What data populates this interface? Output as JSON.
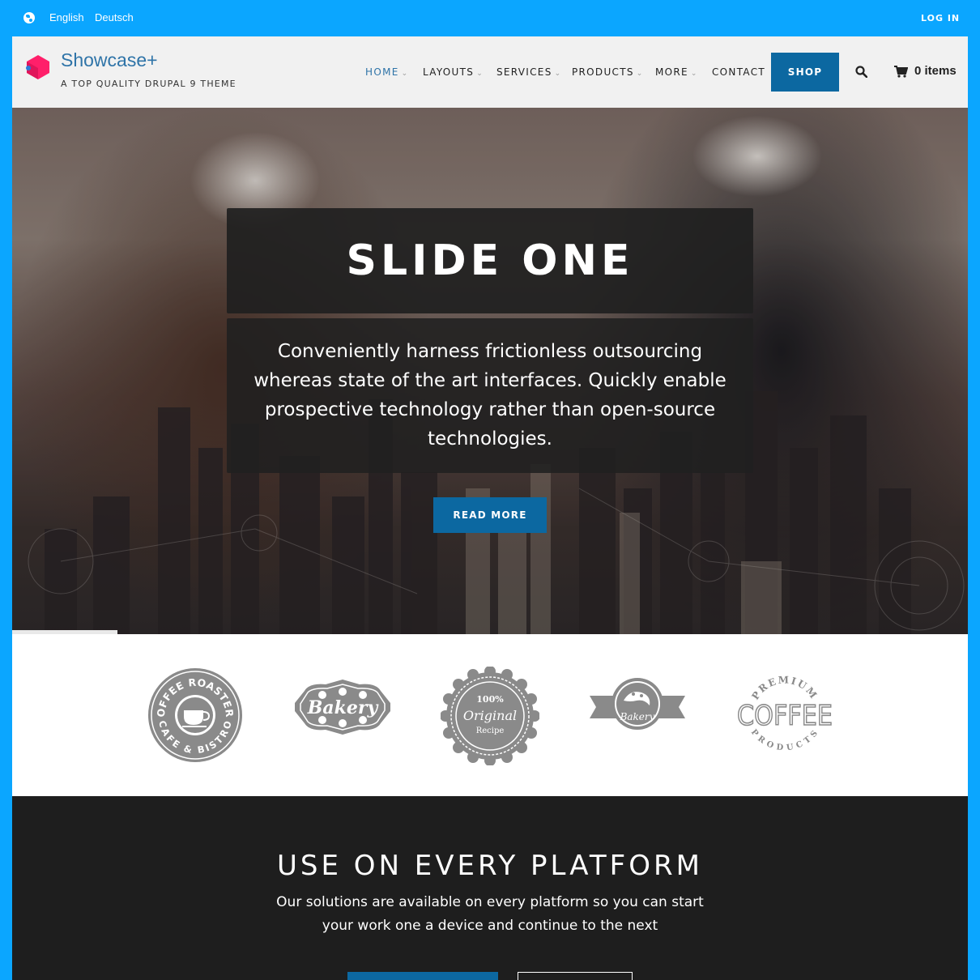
{
  "topbar": {
    "languages": [
      "English",
      "Deutsch"
    ],
    "login_label": "LOG IN"
  },
  "header": {
    "site_name": "Showcase+",
    "slogan": "A TOP QUALITY DRUPAL 9 THEME",
    "nav": [
      {
        "label": "HOME",
        "has_dropdown": true,
        "active": true
      },
      {
        "label": "LAYOUTS",
        "has_dropdown": true
      },
      {
        "label": "SERVICES",
        "has_dropdown": true
      },
      {
        "label": "PRODUCTS",
        "has_dropdown": true
      },
      {
        "label": "MORE",
        "has_dropdown": true
      },
      {
        "label": "CONTACT",
        "has_dropdown": false
      }
    ],
    "shop_label": "SHOP",
    "cart_label": "0 items",
    "icons": {
      "search": "search-icon",
      "cart": "cart-icon",
      "language": "globe-icon",
      "chevron": "chevron-down-icon"
    }
  },
  "slider": {
    "title": "SLIDE ONE",
    "body": "Conveniently harness frictionless outsourcing whereas state of the art interfaces. Quickly enable prospective technology rather than open-source technologies.",
    "button_label": "READ MORE"
  },
  "logos": {
    "coffee_roasters": {
      "top": "COFFEE ROASTERS",
      "bottom": "CAFE & BISTRO"
    },
    "bakery": {
      "text": "Bakery"
    },
    "original_recipe": {
      "line1": "100%",
      "line2": "Original",
      "line3": "Recipe"
    },
    "bakery_badge": {
      "text": "Bakery"
    },
    "premium_coffee": {
      "top": "PREMIUM",
      "middle": "COFFEE",
      "bottom": "PRODUCTS"
    }
  },
  "platform": {
    "title": "USE ON EVERY PLATFORM",
    "subtitle": "Our solutions are available on every platform so you can start your work one a device and continue to the next"
  },
  "colors": {
    "page_bg": "#0ba6ff",
    "accent": "#0c68a1",
    "link": "#2f74a8",
    "logo_pink": "#ff1f6a",
    "dark_bg": "#1e1e1e"
  }
}
